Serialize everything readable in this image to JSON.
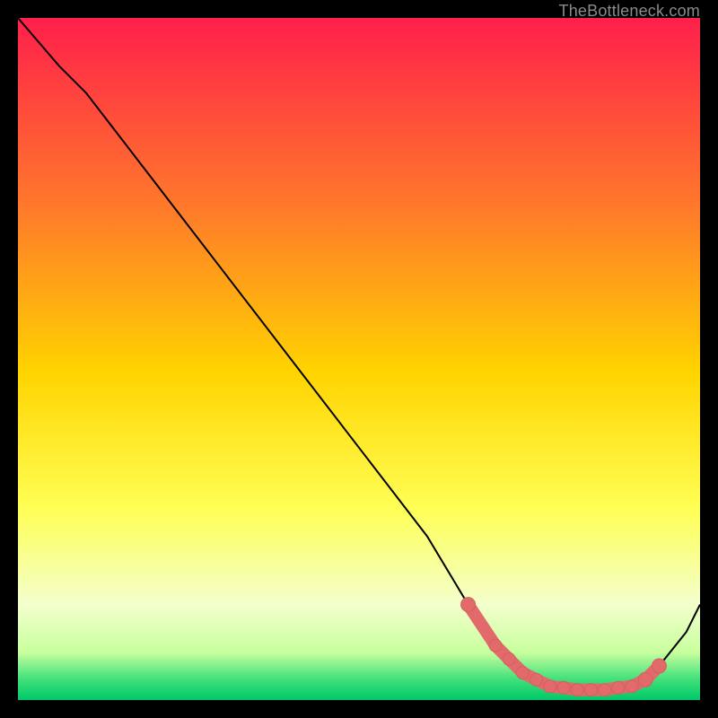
{
  "attribution": "TheBottleneck.com",
  "colors": {
    "grad_top": "#ff1f4b",
    "grad_mid1": "#ff7a2a",
    "grad_mid2": "#ffd400",
    "grad_mid3": "#ffff55",
    "grad_mid4": "#f3ffcc",
    "grad_bot1": "#c8ff9e",
    "grad_bot2": "#3fe07a",
    "grad_bot3": "#00c86a",
    "curve": "#000000",
    "marker_fill": "#e26a6a",
    "marker_stroke": "#d35f5f"
  },
  "chart_data": {
    "type": "line",
    "title": "",
    "xlabel": "",
    "ylabel": "",
    "xlim": [
      0,
      100
    ],
    "ylim": [
      0,
      100
    ],
    "series": [
      {
        "name": "bottleneck-curve",
        "x": [
          0,
          6,
          10,
          20,
          30,
          40,
          50,
          60,
          66,
          70,
          74,
          78,
          82,
          86,
          90,
          94,
          98,
          100
        ],
        "y": [
          100,
          93,
          89,
          76,
          63,
          50,
          37,
          24,
          14,
          8,
          4,
          2,
          1.5,
          1.5,
          2,
          5,
          10,
          14
        ]
      }
    ],
    "markers": {
      "name": "highlighted-points",
      "x": [
        66,
        70,
        72,
        74,
        76,
        78,
        80,
        82,
        84,
        86,
        88,
        90,
        92,
        94
      ],
      "y": [
        14,
        8,
        6,
        4,
        3,
        2,
        1.8,
        1.5,
        1.5,
        1.5,
        1.8,
        2,
        3,
        5
      ]
    }
  }
}
